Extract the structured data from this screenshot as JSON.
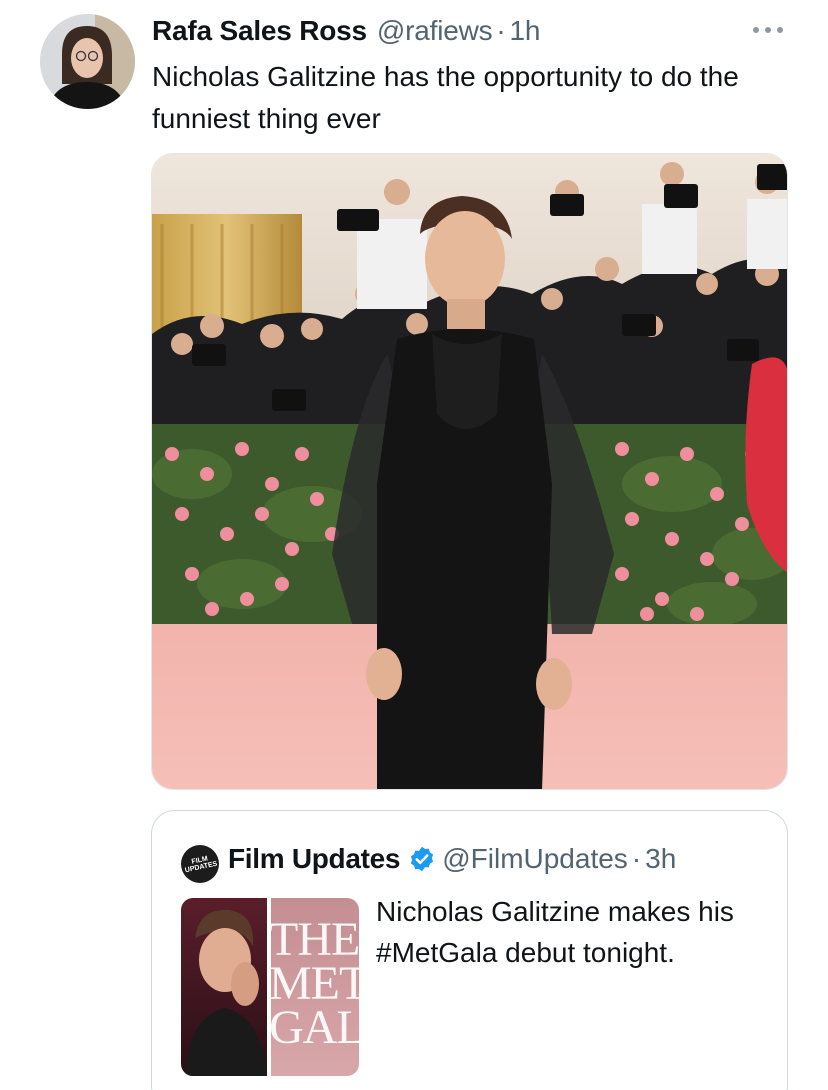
{
  "tweet": {
    "author": {
      "display_name": "Rafa Sales Ross",
      "handle": "@rafiews",
      "time": "1h"
    },
    "separator": "·",
    "text": "Nicholas Galitzine has the opportunity to do the funniest thing ever",
    "more_icon": "ellipsis-icon"
  },
  "quote": {
    "author": {
      "display_name": "Film Updates",
      "handle": "@FilmUpdates",
      "time": "3h",
      "avatar_text": "FILM\nUPDATES",
      "verified_color": "#1d9bf0"
    },
    "separator": "·",
    "thumbnail_text": "THE\nMET\nGAL",
    "text": "Nicholas Galitzine makes his #MetGala debut tonight."
  },
  "colors": {
    "text_primary": "#0f1419",
    "text_secondary": "#536471",
    "border": "#cfd9de",
    "verified": "#1d9bf0"
  }
}
